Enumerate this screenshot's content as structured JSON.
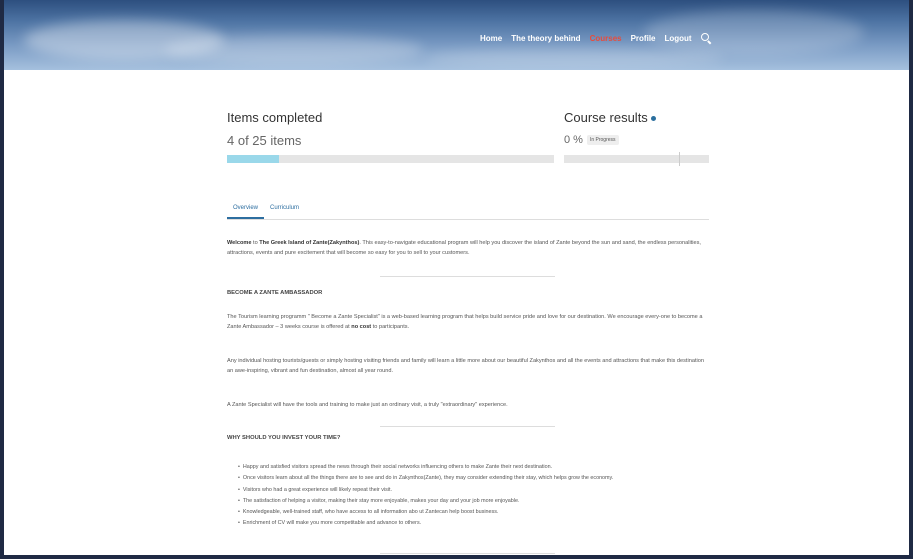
{
  "nav": {
    "items": [
      "Home",
      "The theory behind",
      "Courses",
      "Profile",
      "Logout"
    ],
    "active_index": 2
  },
  "stats": {
    "items_title": "Items completed",
    "items_count": "4 of 25 items",
    "items_progress_percent": 16,
    "course_title": "Course results",
    "course_value": "0 %",
    "course_status": "In Progress"
  },
  "tabs": [
    "Overview",
    "Curriculum"
  ],
  "overview": {
    "welcome_prefix": "Welcome",
    "welcome_mid": "to",
    "island_name": "The Greek Island of Zante(Zakynthos)",
    "welcome_rest": ". This easy-to-navigate educational program will help you discover the island of Zante beyond the sun and sand, the endless personalities, attractions, events and pure excitement that will become so easy for you to sell to your customers.",
    "heading_ambassador": "BECOME A ZANTE AMBASSADOR",
    "para1_start": "The Tourism learning programm \" Become a Zante Specialist\" is a web-based learning program that helps build service pride and love for our destination.  We encourage every-one to become a Zante Ambassador – 3 weeks course is offered at",
    "para1_bold": "no cost",
    "para1_end": "to participants.",
    "para2": "Any individual hosting tourists/guests or simply hosting visiting friends and family will learn a little more about our beautiful Zakynthos and all the events and attractions that make this destination an awe-inspiring, vibrant and fun destination, almost all year round.",
    "para3": "A Zante Specialist will have the tools and training to make just an ordinary visit, a truly \"extraordinary\" experience.",
    "heading_invest": "WHY SHOULD YOU INVEST YOUR TIME?",
    "bullets": [
      "Happy and satisfied visitors spread the news through their social networks influencing others to make Zante their next destination.",
      "Once visitors learn about all the things there are to see and do in Zakynthos(Zante), they may consider extending their stay, which helps grow the economy.",
      "Visitors who had a great experience will likely repeat their visit.",
      "The satisfaction of helping a visitor, making their stay more enjoyable, makes your day and your job more enjoyable.",
      "Knowledgeable, well-trained staff, who have access to all information abo ut Zantecan help boost business.",
      "Enrichment of CV  will make you more competitable and advance to others."
    ]
  },
  "colors": {
    "accent": "#2d6ea0",
    "active_nav": "#e74c3c",
    "progress_fill": "#9ad8ea"
  }
}
